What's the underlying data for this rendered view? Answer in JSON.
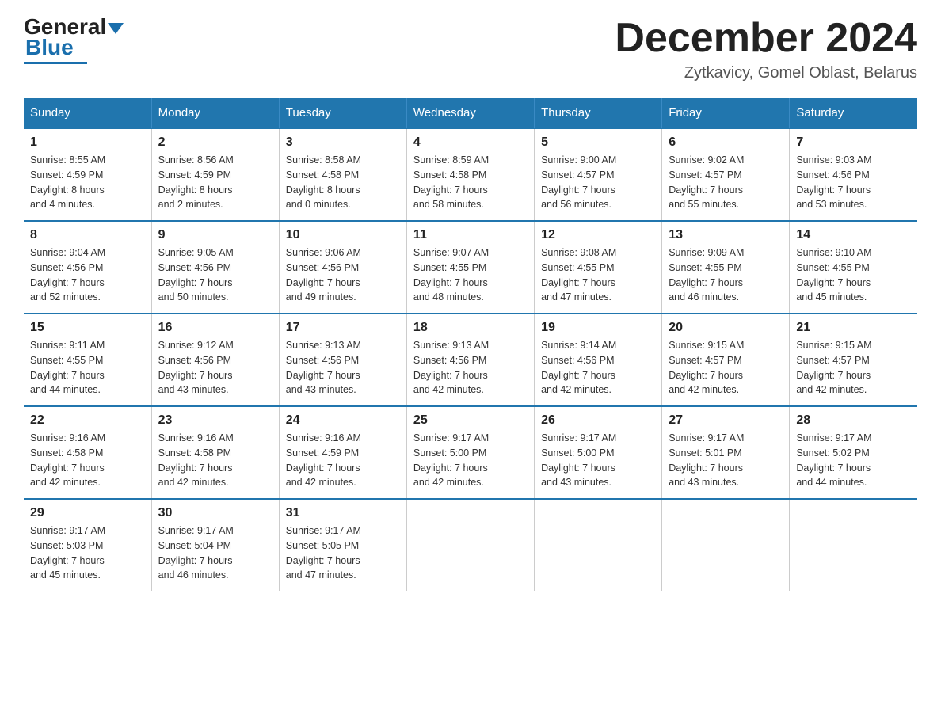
{
  "header": {
    "logo_text_general": "General",
    "logo_text_blue": "Blue",
    "month_title": "December 2024",
    "location": "Zytkavicy, Gomel Oblast, Belarus"
  },
  "weekdays": [
    "Sunday",
    "Monday",
    "Tuesday",
    "Wednesday",
    "Thursday",
    "Friday",
    "Saturday"
  ],
  "weeks": [
    [
      {
        "day": "1",
        "info": "Sunrise: 8:55 AM\nSunset: 4:59 PM\nDaylight: 8 hours\nand 4 minutes."
      },
      {
        "day": "2",
        "info": "Sunrise: 8:56 AM\nSunset: 4:59 PM\nDaylight: 8 hours\nand 2 minutes."
      },
      {
        "day": "3",
        "info": "Sunrise: 8:58 AM\nSunset: 4:58 PM\nDaylight: 8 hours\nand 0 minutes."
      },
      {
        "day": "4",
        "info": "Sunrise: 8:59 AM\nSunset: 4:58 PM\nDaylight: 7 hours\nand 58 minutes."
      },
      {
        "day": "5",
        "info": "Sunrise: 9:00 AM\nSunset: 4:57 PM\nDaylight: 7 hours\nand 56 minutes."
      },
      {
        "day": "6",
        "info": "Sunrise: 9:02 AM\nSunset: 4:57 PM\nDaylight: 7 hours\nand 55 minutes."
      },
      {
        "day": "7",
        "info": "Sunrise: 9:03 AM\nSunset: 4:56 PM\nDaylight: 7 hours\nand 53 minutes."
      }
    ],
    [
      {
        "day": "8",
        "info": "Sunrise: 9:04 AM\nSunset: 4:56 PM\nDaylight: 7 hours\nand 52 minutes."
      },
      {
        "day": "9",
        "info": "Sunrise: 9:05 AM\nSunset: 4:56 PM\nDaylight: 7 hours\nand 50 minutes."
      },
      {
        "day": "10",
        "info": "Sunrise: 9:06 AM\nSunset: 4:56 PM\nDaylight: 7 hours\nand 49 minutes."
      },
      {
        "day": "11",
        "info": "Sunrise: 9:07 AM\nSunset: 4:55 PM\nDaylight: 7 hours\nand 48 minutes."
      },
      {
        "day": "12",
        "info": "Sunrise: 9:08 AM\nSunset: 4:55 PM\nDaylight: 7 hours\nand 47 minutes."
      },
      {
        "day": "13",
        "info": "Sunrise: 9:09 AM\nSunset: 4:55 PM\nDaylight: 7 hours\nand 46 minutes."
      },
      {
        "day": "14",
        "info": "Sunrise: 9:10 AM\nSunset: 4:55 PM\nDaylight: 7 hours\nand 45 minutes."
      }
    ],
    [
      {
        "day": "15",
        "info": "Sunrise: 9:11 AM\nSunset: 4:55 PM\nDaylight: 7 hours\nand 44 minutes."
      },
      {
        "day": "16",
        "info": "Sunrise: 9:12 AM\nSunset: 4:56 PM\nDaylight: 7 hours\nand 43 minutes."
      },
      {
        "day": "17",
        "info": "Sunrise: 9:13 AM\nSunset: 4:56 PM\nDaylight: 7 hours\nand 43 minutes."
      },
      {
        "day": "18",
        "info": "Sunrise: 9:13 AM\nSunset: 4:56 PM\nDaylight: 7 hours\nand 42 minutes."
      },
      {
        "day": "19",
        "info": "Sunrise: 9:14 AM\nSunset: 4:56 PM\nDaylight: 7 hours\nand 42 minutes."
      },
      {
        "day": "20",
        "info": "Sunrise: 9:15 AM\nSunset: 4:57 PM\nDaylight: 7 hours\nand 42 minutes."
      },
      {
        "day": "21",
        "info": "Sunrise: 9:15 AM\nSunset: 4:57 PM\nDaylight: 7 hours\nand 42 minutes."
      }
    ],
    [
      {
        "day": "22",
        "info": "Sunrise: 9:16 AM\nSunset: 4:58 PM\nDaylight: 7 hours\nand 42 minutes."
      },
      {
        "day": "23",
        "info": "Sunrise: 9:16 AM\nSunset: 4:58 PM\nDaylight: 7 hours\nand 42 minutes."
      },
      {
        "day": "24",
        "info": "Sunrise: 9:16 AM\nSunset: 4:59 PM\nDaylight: 7 hours\nand 42 minutes."
      },
      {
        "day": "25",
        "info": "Sunrise: 9:17 AM\nSunset: 5:00 PM\nDaylight: 7 hours\nand 42 minutes."
      },
      {
        "day": "26",
        "info": "Sunrise: 9:17 AM\nSunset: 5:00 PM\nDaylight: 7 hours\nand 43 minutes."
      },
      {
        "day": "27",
        "info": "Sunrise: 9:17 AM\nSunset: 5:01 PM\nDaylight: 7 hours\nand 43 minutes."
      },
      {
        "day": "28",
        "info": "Sunrise: 9:17 AM\nSunset: 5:02 PM\nDaylight: 7 hours\nand 44 minutes."
      }
    ],
    [
      {
        "day": "29",
        "info": "Sunrise: 9:17 AM\nSunset: 5:03 PM\nDaylight: 7 hours\nand 45 minutes."
      },
      {
        "day": "30",
        "info": "Sunrise: 9:17 AM\nSunset: 5:04 PM\nDaylight: 7 hours\nand 46 minutes."
      },
      {
        "day": "31",
        "info": "Sunrise: 9:17 AM\nSunset: 5:05 PM\nDaylight: 7 hours\nand 47 minutes."
      },
      {
        "day": "",
        "info": ""
      },
      {
        "day": "",
        "info": ""
      },
      {
        "day": "",
        "info": ""
      },
      {
        "day": "",
        "info": ""
      }
    ]
  ]
}
